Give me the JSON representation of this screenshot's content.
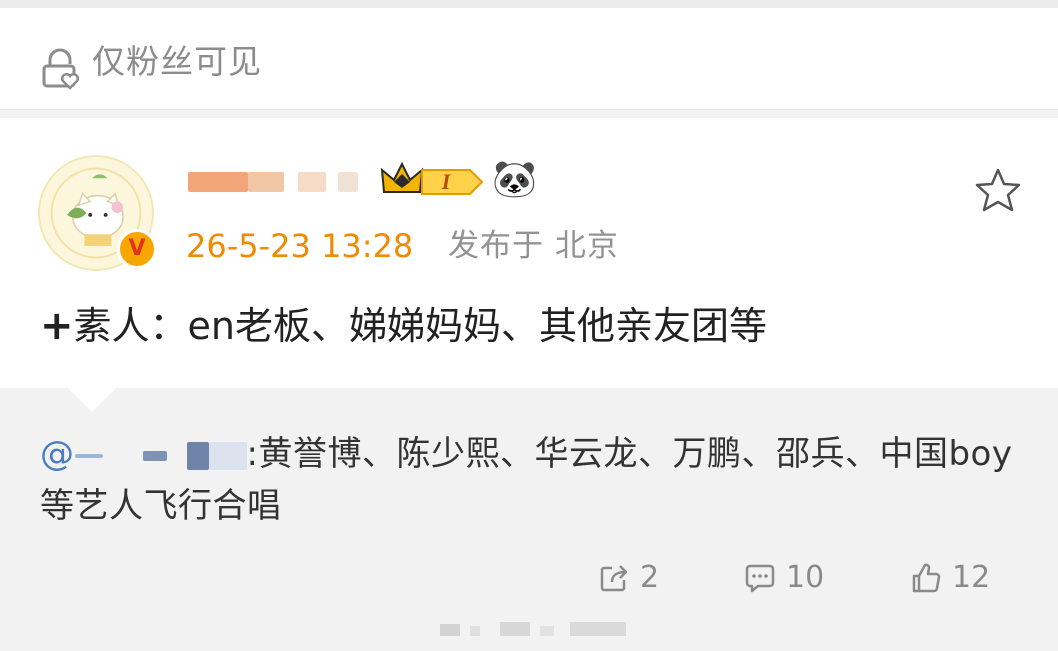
{
  "privacy": {
    "label": "仅粉丝可见",
    "icon": "lock-heart-icon"
  },
  "post": {
    "author_name": "",
    "verified_badge": "V",
    "level_badge": "I",
    "emoji": "🐼",
    "time": "26-5-23 13:28",
    "location_label": "发布于 北京",
    "plus_sign": "+",
    "text": "素人：en老板、娣娣妈妈、其他亲友团等"
  },
  "repost": {
    "mention_prefix": "@",
    "text": ":黄誉博、陈少熙、华云龙、万鹏、邵兵、中国boy等艺人飞行合唱"
  },
  "actions": {
    "share_count": "2",
    "comment_count": "10",
    "like_count": "12"
  },
  "colors": {
    "accent_time": "#f08a00",
    "mention": "#4a7cc2",
    "meta_gray": "#939393",
    "verified_orange": "#f7a700",
    "verified_red": "#e0321f"
  }
}
